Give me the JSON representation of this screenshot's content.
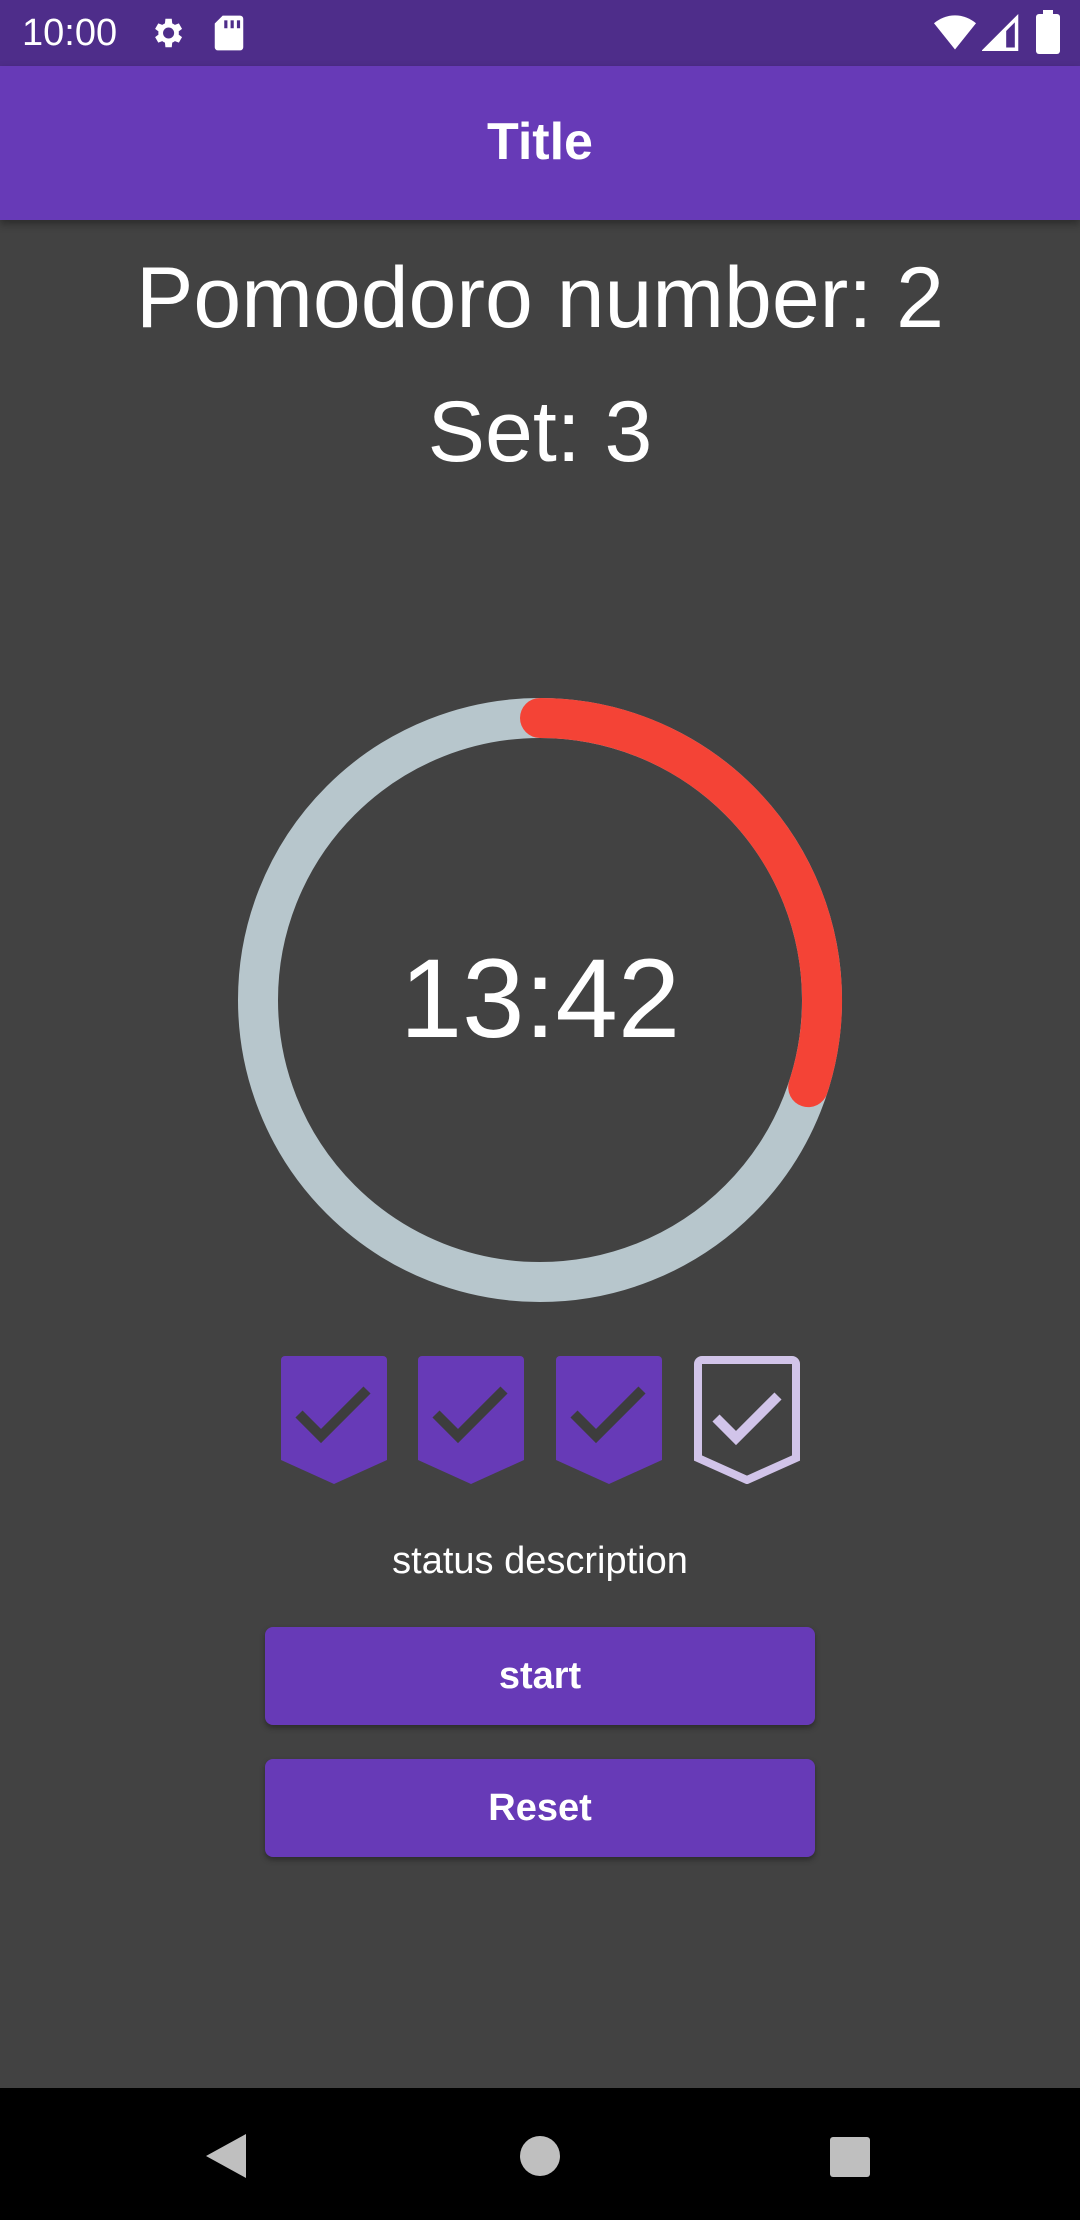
{
  "status_bar": {
    "time": "10:00",
    "icons_left": [
      "settings-icon",
      "sd-card-icon"
    ],
    "icons_right": [
      "wifi-icon",
      "signal-icon",
      "battery-icon"
    ],
    "color": "#4e2d8a"
  },
  "app_bar": {
    "title": "Title",
    "color": "#673ab7"
  },
  "main": {
    "pomodoro_label": "Pomodoro number: 2",
    "set_label": "Set: 3",
    "timer": {
      "time_remaining": "13:42",
      "progress_fraction": 0.3,
      "track_color": "#b7c6cc",
      "progress_color": "#f44336"
    },
    "badges": [
      {
        "state": "completed",
        "icon": "check-badge-icon"
      },
      {
        "state": "completed",
        "icon": "check-badge-icon"
      },
      {
        "state": "completed",
        "icon": "check-badge-icon"
      },
      {
        "state": "pending",
        "icon": "check-badge-outline-icon"
      }
    ],
    "status_description": "status description",
    "start_label": "start",
    "reset_label": "Reset"
  },
  "nav_bar": {
    "buttons": [
      "back-icon",
      "home-icon",
      "recents-icon"
    ]
  },
  "colors": {
    "background": "#424242",
    "accent": "#673ab7",
    "badge_pending": "#d1c4e9"
  }
}
